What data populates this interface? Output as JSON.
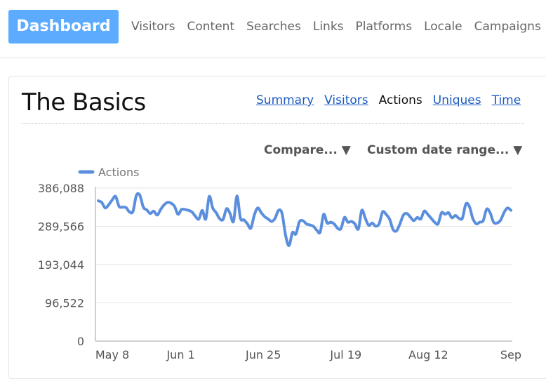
{
  "nav": {
    "primary": "Dashboard",
    "items": [
      "Visitors",
      "Content",
      "Searches",
      "Links",
      "Platforms",
      "Locale",
      "Campaigns"
    ]
  },
  "section": {
    "title": "The Basics",
    "tabs": [
      {
        "label": "Summary",
        "active": false
      },
      {
        "label": "Visitors",
        "active": false
      },
      {
        "label": "Actions",
        "active": true
      },
      {
        "label": "Uniques",
        "active": false
      },
      {
        "label": "Time",
        "active": false
      }
    ]
  },
  "controls": {
    "compare": "Compare... ▼",
    "date_range": "Custom date range... ▼"
  },
  "colors": {
    "accent": "#5cabff",
    "series": "#5b8fdd",
    "link": "#1a5bbf"
  },
  "chart_data": {
    "type": "line",
    "legend": [
      "Actions"
    ],
    "y_ticks": [
      "386,088",
      "289,566",
      "193,044",
      "96,522",
      "0"
    ],
    "y_tick_values": [
      386088,
      289566,
      193044,
      96522,
      0
    ],
    "ylim": [
      0,
      386088
    ],
    "x_ticks": [
      "May 8",
      "Jun 1",
      "Jun 25",
      "Jul 19",
      "Aug 12",
      "Sep"
    ],
    "x_tick_days": [
      0,
      24,
      48,
      72,
      96,
      120
    ],
    "grid": true,
    "series": [
      {
        "name": "Actions",
        "values": [
          354000,
          350000,
          336000,
          344000,
          356000,
          365000,
          340000,
          338000,
          337000,
          326000,
          327000,
          368000,
          368000,
          338000,
          331000,
          322000,
          328000,
          318000,
          332000,
          344000,
          350000,
          348000,
          340000,
          320000,
          332000,
          332000,
          330000,
          326000,
          315000,
          308000,
          330000,
          308000,
          365000,
          336000,
          324000,
          309000,
          307000,
          334000,
          322000,
          302000,
          366000,
          310000,
          306000,
          296000,
          285000,
          318000,
          336000,
          324000,
          314000,
          308000,
          302000,
          310000,
          330000,
          322000,
          268000,
          241000,
          274000,
          270000,
          301000,
          304000,
          296000,
          293000,
          290000,
          280000,
          275000,
          320000,
          298000,
          300000,
          296000,
          285000,
          284000,
          312000,
          300000,
          302000,
          296000,
          283000,
          330000,
          310000,
          292000,
          298000,
          290000,
          296000,
          326000,
          320000,
          308000,
          282000,
          278000,
          296000,
          318000,
          322000,
          313000,
          304000,
          312000,
          308000,
          328000,
          320000,
          310000,
          300000,
          296000,
          324000,
          320000,
          324000,
          311000,
          317000,
          310000,
          310000,
          346000,
          340000,
          310000,
          296000,
          300000,
          304000,
          333000,
          324000,
          300000,
          298000,
          305000,
          324000,
          336000,
          330000
        ]
      }
    ]
  }
}
